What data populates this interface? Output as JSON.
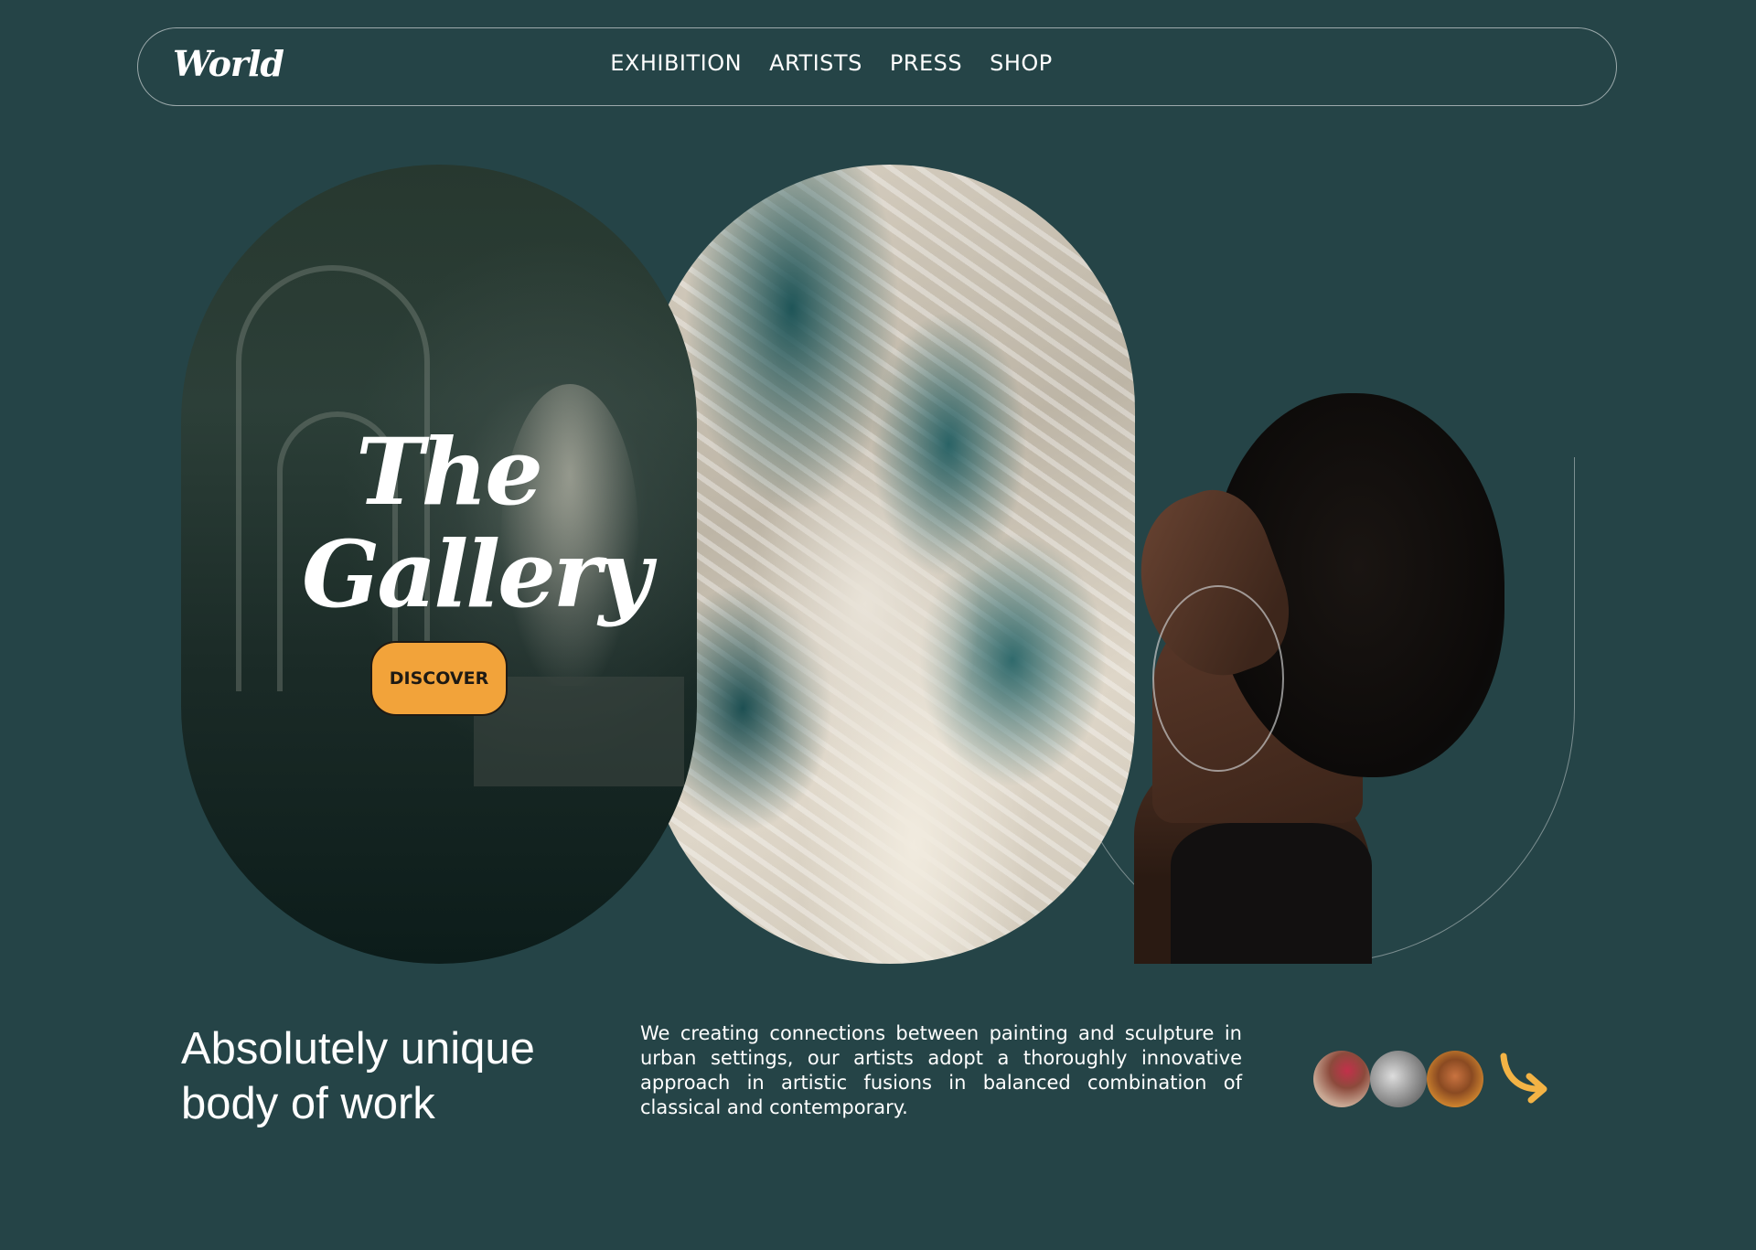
{
  "header": {
    "logo": "World",
    "nav": [
      "EXHIBITION",
      "ARTISTS",
      "PRESS",
      "SHOP"
    ]
  },
  "hero": {
    "title_line1": "The",
    "title_line2": "Gallery",
    "cta_label": "DISCOVER"
  },
  "intro": {
    "headline_line1": "Absolutely unique",
    "headline_line2": "body of work",
    "description": "We creating connections between painting and sculpture in urban settings, our artists adopt a thoroughly innovative approach in artistic fusions in balanced combination of classical and contemporary."
  },
  "colors": {
    "background": "#254447",
    "accent": "#f2a33a",
    "arrow": "#f3b345",
    "text": "#ffffff"
  },
  "icons": {
    "avatars": [
      "artist-avatar-1",
      "artist-avatar-2",
      "artist-avatar-3"
    ],
    "arrow": "curved-arrow-icon"
  }
}
